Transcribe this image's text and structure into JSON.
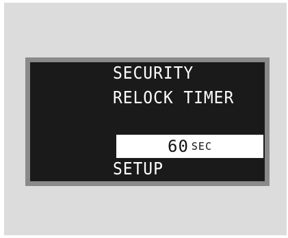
{
  "display": {
    "line1": "SECURITY",
    "line2": "RELOCK TIMER",
    "value": "60",
    "unit": "SEC",
    "line3": "SETUP"
  }
}
